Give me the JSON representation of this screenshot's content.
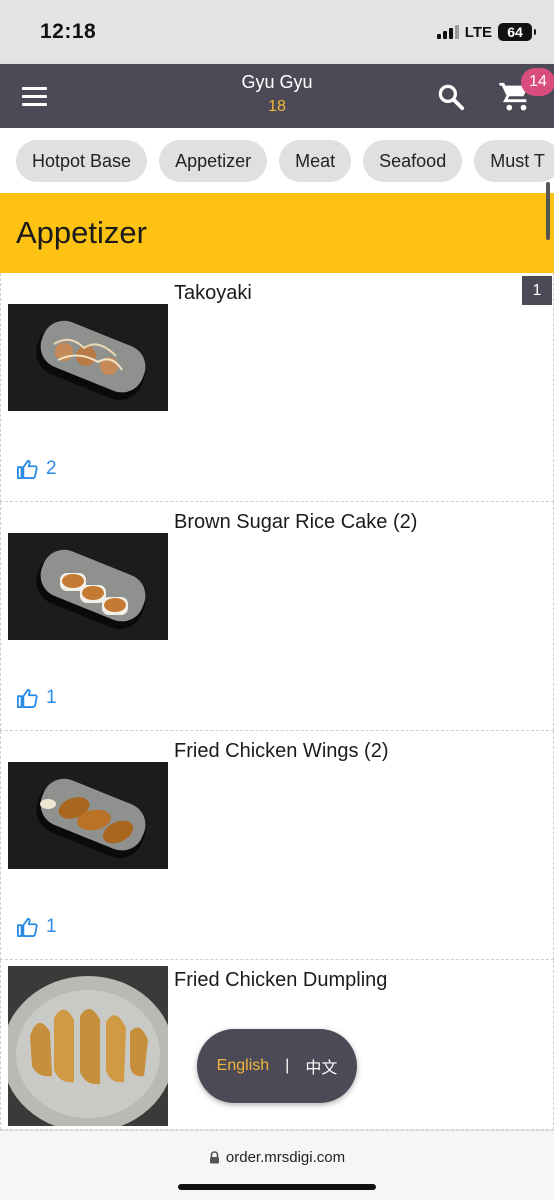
{
  "status_bar": {
    "time": "12:18",
    "network": "LTE",
    "battery": "64"
  },
  "header": {
    "title": "Gyu Gyu",
    "table_number": "18",
    "cart_count": "14"
  },
  "categories": [
    "Hotpot Base",
    "Appetizer",
    "Meat",
    "Seafood",
    "Must T"
  ],
  "section": {
    "title": "Appetizer"
  },
  "items": [
    {
      "name": "Takoyaki",
      "likes": "2",
      "quantity": "1"
    },
    {
      "name": "Brown Sugar Rice Cake (2)",
      "likes": "1"
    },
    {
      "name": "Fried Chicken Wings (2)",
      "likes": "1"
    },
    {
      "name": "Fried Chicken Dumpling"
    }
  ],
  "language": {
    "english": "English",
    "separator": "|",
    "chinese": "中文"
  },
  "browser": {
    "url": "order.mrsdigi.com"
  },
  "colors": {
    "header": "#4b4a56",
    "accent": "#f4b63a",
    "section": "#fdc212",
    "badge": "#d94d7e",
    "like": "#2a8be4"
  },
  "icons": {
    "menu": "menu-icon",
    "search": "search-icon",
    "cart": "cart-icon",
    "like": "thumbs-up-icon",
    "lock": "lock-icon"
  }
}
